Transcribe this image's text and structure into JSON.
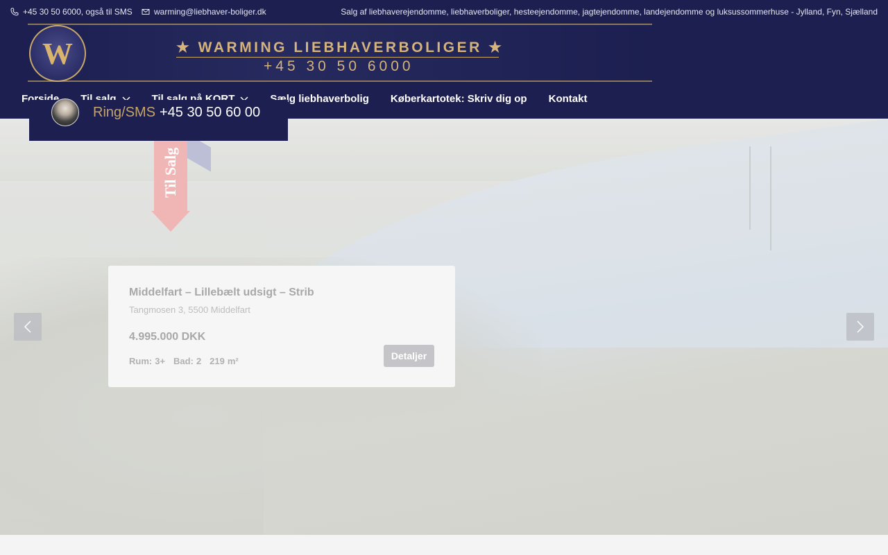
{
  "topbar": {
    "phone": "+45 30 50 6000, også til SMS",
    "email": "warming@liebhaver-boliger.dk",
    "tagline": "Salg af liebhaverejendomme, liebhaverboliger, hesteejendomme, jagtejendomme, landejendomme og luksussommerhuse - Jylland, Fyn, Sjælland"
  },
  "logo": {
    "title": "★ WARMING LIEBHAVERBOLIGER ★",
    "phone": "+45 30 50 6000",
    "badge_letter": "W"
  },
  "nav": {
    "items": [
      {
        "label": "Forside",
        "has_dropdown": false
      },
      {
        "label": "Til salg",
        "has_dropdown": true
      },
      {
        "label": "Til salg på KORT",
        "has_dropdown": true
      },
      {
        "label": "Sælg liebhaverbolig",
        "has_dropdown": false
      },
      {
        "label": "Køberkartotek: Skriv dig op",
        "has_dropdown": false
      },
      {
        "label": "Kontakt",
        "has_dropdown": false
      }
    ]
  },
  "callbox": {
    "label": "Ring/SMS",
    "number": "+45 30 50 60 00"
  },
  "ribbon": {
    "text": "Til Salg"
  },
  "listing": {
    "title": "Middelfart – Lillebælt udsigt – Strib",
    "address": "Tangmosen 3, 5500 Middelfart",
    "price": "4.995.000 DKK",
    "rooms_label": "Rum:",
    "rooms_value": "3+",
    "baths_label": "Bad:",
    "baths_value": "2",
    "area_value": "219",
    "area_unit": "m²",
    "details_button": "Detaljer"
  },
  "colors": {
    "header_bg": "#1c1f50",
    "gold": "#c6a468",
    "ribbon": "#f0b6b6"
  },
  "icons": {
    "phone": "phone-icon",
    "email": "envelope-icon",
    "dropdown": "chevron-down-icon",
    "prev": "chevron-left-icon",
    "next": "chevron-right-icon"
  }
}
